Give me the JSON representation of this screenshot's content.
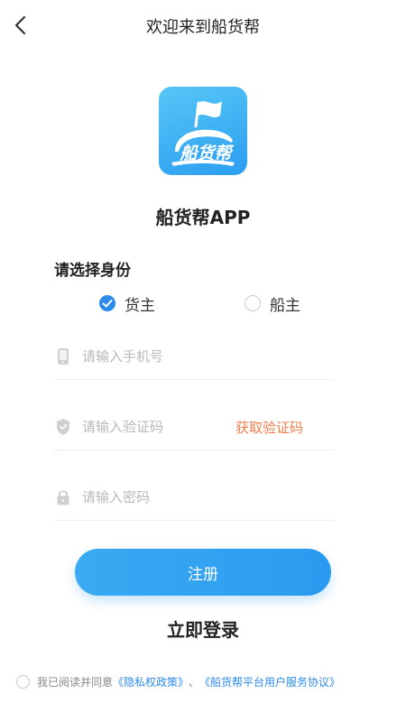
{
  "header": {
    "title": "欢迎来到船货帮"
  },
  "app": {
    "logo_text": "船货帮",
    "name": "船货帮APP"
  },
  "role": {
    "title": "请选择身份",
    "options": [
      {
        "label": "货主",
        "selected": true
      },
      {
        "label": "船主",
        "selected": false
      }
    ]
  },
  "form": {
    "phone_placeholder": "请输入手机号",
    "code_placeholder": "请输入验证码",
    "get_code_label": "获取验证码",
    "password_placeholder": "请输入密码"
  },
  "actions": {
    "register_label": "注册",
    "login_label": "立即登录"
  },
  "agreement": {
    "prefix": "我已阅读并同意",
    "privacy_link": "《隐私权政策》",
    "separator": "、",
    "service_link": "《船货帮平台用户服务协议》"
  },
  "colors": {
    "accent": "#2d8bec",
    "button": "#2a9af0",
    "get_code": "#ef7d4b"
  }
}
